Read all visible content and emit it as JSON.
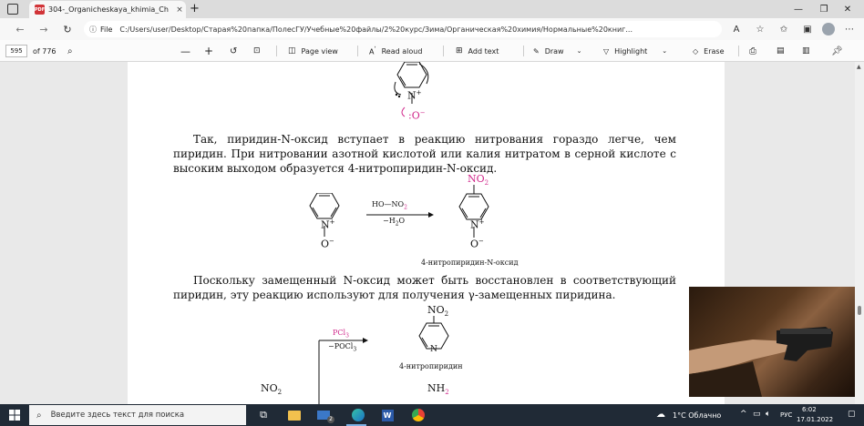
{
  "browser": {
    "tab_title": "304-_Organicheskaya_khimia_Ch",
    "tab_close": "×",
    "new_tab": "+",
    "pdf_badge": "PDF",
    "window": {
      "minimize": "—",
      "restore": "❐",
      "close": "✕"
    },
    "nav": {
      "back": "←",
      "forward": "→",
      "refresh": "↻"
    },
    "url_info": "ⓘ",
    "url_label": "File",
    "url": "C:/Users/user/Desktop/Старая%20папка/ПолесГУ/Учебные%20файлы/2%20курс/Зима/Органическая%20химия/Нормальные%20книг..."
  },
  "pdf_toolbar": {
    "page_number": "595",
    "page_total": "of 776",
    "page_view": "Page view",
    "read_aloud": "Read aloud",
    "add_text": "Add text",
    "draw": "Draw",
    "highlight": "Highlight",
    "erase": "Erase"
  },
  "document": {
    "para1": "Так, пиридин-N-оксид вступает в реакцию нитрования гораздо легче, чем пиридин. При нитровании азотной кислотой или калия нитратом в серной кислоте с высоким выходом образуется 4-нитропиридин-N-оксид.",
    "para2": "Поскольку замещенный N-оксид может быть восстановлен в соответствующий пиридин, эту реакцию используют для получения γ-замещенных пиридина.",
    "top_N": "N",
    "top_plus": "+",
    "top_O": ":O",
    "top_O_charge": "−",
    "reagent_top": "HO—NO",
    "reagent_top_sub": "2",
    "reagent_bottom": "−H",
    "reagent_bottom_sub": "2",
    "reagent_bottom_end": "O",
    "left_N": "N",
    "left_plus": "+",
    "left_O": "O",
    "left_O_charge": "−",
    "right_NO": "NO",
    "right_NO_sub": "2",
    "right_N": "N",
    "right_plus": "+",
    "right_O": "O",
    "right_O_charge": "−",
    "label1": "4-нитропиридин-N-оксид",
    "pcl_top": "PCl",
    "pcl_top_sub": "3",
    "pcl_bottom": "−POCl",
    "pcl_bottom_sub": "3",
    "np_NO": "NO",
    "np_NO_sub": "2",
    "np_N": "N",
    "label2": "4-нитропиридин",
    "bottom_left_NO": "NO",
    "bottom_left_NO_sub": "2",
    "bottom_right_NH": "NH",
    "bottom_right_NH_sub": "2"
  },
  "taskbar": {
    "search_placeholder": "Введите здесь текст для поиска",
    "mail_badge": "2",
    "weather": "1°C Облачно",
    "lang": "РУС",
    "time": "6:02",
    "date": "17.01.2022"
  },
  "colors": {
    "accent_magenta": "#d0268a",
    "taskbar": "#202a36"
  }
}
